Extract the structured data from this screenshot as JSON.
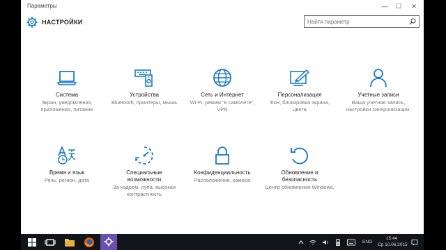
{
  "window": {
    "title": "Параметры"
  },
  "header": {
    "title": "НАСТРОЙКИ"
  },
  "search": {
    "placeholder": "Найти параметр"
  },
  "tiles": [
    {
      "name": "Система",
      "desc": "Экран, уведомления, приложения, питание",
      "icon": "laptop-icon"
    },
    {
      "name": "Устройства",
      "desc": "Bluetooth, принтеры, мышь",
      "icon": "devices-icon"
    },
    {
      "name": "Сеть и Интернет",
      "desc": "Wi-Fi, режим \"в самолете\", VPN",
      "icon": "globe-icon"
    },
    {
      "name": "Персонализация",
      "desc": "Фон, блокировка экрана, цвета",
      "icon": "personalization-icon"
    },
    {
      "name": "Учетные записи",
      "desc": "Ваша учетная запись, настройки синхронизации.",
      "icon": "user-icon"
    },
    {
      "name": "Время и язык",
      "desc": "Речь, регион, дата",
      "icon": "time-language-icon"
    },
    {
      "name": "Специальные возможности",
      "desc": "За кадром, лупа, высокая контрастность",
      "icon": "ease-of-access-icon"
    },
    {
      "name": "Конфиденциальность",
      "desc": "Расположение, камера",
      "icon": "lock-icon"
    },
    {
      "name": "Обновление и безопасность",
      "desc": "Центр обновления Windows,",
      "icon": "update-icon"
    }
  ],
  "tray": {
    "lang": "ENG",
    "time": "15:44",
    "date": "Ср 10.06.2015"
  },
  "colors": {
    "accent": "#1979ca",
    "taskbar": "#111418",
    "active_app": "#6a4fb0"
  }
}
